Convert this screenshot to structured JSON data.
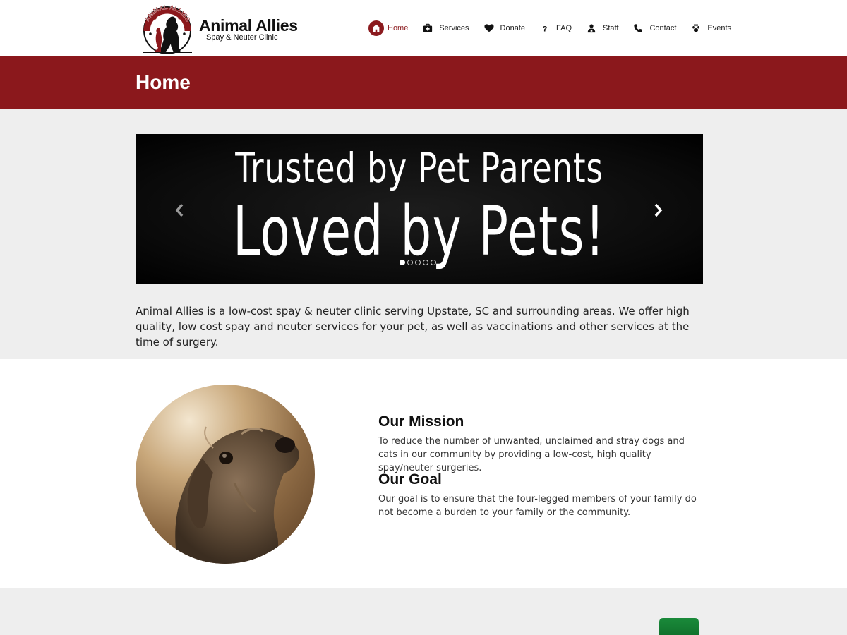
{
  "logo": {
    "title": "Animal Allies",
    "subtitle": "Spay & Neuter Clinic",
    "arc_text": "ANIMAL ALLIES"
  },
  "nav": {
    "items": [
      {
        "label": "Home",
        "icon": "home-icon",
        "active": true
      },
      {
        "label": "Services",
        "icon": "medical-kit-icon",
        "active": false
      },
      {
        "label": "Donate",
        "icon": "heart-icon",
        "active": false
      },
      {
        "label": "FAQ",
        "icon": "question-icon",
        "active": false
      },
      {
        "label": "Staff",
        "icon": "staff-person-icon",
        "active": false
      },
      {
        "label": "Contact",
        "icon": "phone-icon",
        "active": false
      },
      {
        "label": "Events",
        "icon": "paw-icon",
        "active": false
      }
    ]
  },
  "page": {
    "title": "Home"
  },
  "slider": {
    "line1": "Trusted by Pet Parents",
    "line2": "Loved by Pets!",
    "slide_count": 5,
    "active_slide": 1
  },
  "intro": {
    "text": "Animal Allies is a low-cost spay & neuter clinic serving Upstate, SC and surrounding areas. We offer high quality, low cost spay and neuter services for your pet, as well as vaccinations and other services at the time of surgery."
  },
  "mission": {
    "heading": "Our Mission",
    "text": "To reduce the number of unwanted, unclaimed and stray dogs and cats in our community by providing a low-cost, high quality spay/neuter surgeries."
  },
  "goal": {
    "heading": "Our Goal",
    "text": "Our goal is to ensure that the four-legged members of your family do not become a burden to your family or the community."
  },
  "colors": {
    "brand_red": "#8b181c",
    "section_gray": "#eeeeee",
    "button_green": "#1a8a3a"
  }
}
